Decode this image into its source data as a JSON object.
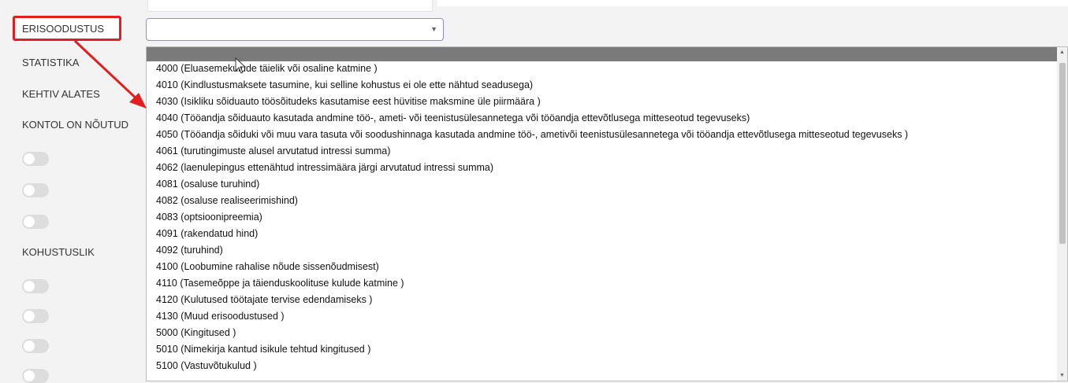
{
  "labels": {
    "erisoodustus": "ERISOODUSTUS",
    "statistika": "STATISTIKA",
    "kehtiv_alates": "KEHTIV ALATES",
    "kontol_on_noutud": "KONTOL ON NÕUTUD",
    "kohustuslik": "KOHUSTUSLIK"
  },
  "select": {
    "value": "",
    "caret": "▼"
  },
  "dropdown": {
    "options": [
      "4000 (Eluasemekulude täielik või osaline katmine )",
      "4010 (Kindlustusmaksete tasumine, kui selline kohustus ei ole ette nähtud seadusega)",
      "4030 (Isikliku sõiduauto töösõitudeks kasutamise eest hüvitise maksmine üle piirmäära )",
      "4040 (Tööandja sõiduauto kasutada andmine töö-, ameti- või teenistusülesannetega või tööandja ettevõtlusega mitteseotud tegevuseks)",
      "4050 (Tööandja sõiduki või muu vara tasuta või soodushinnaga kasutada andmine töö-, ametivõi teenistusülesannetega või tööandja ettevõtlusega mitteseotud tegevuseks )",
      "4061 (turutingimuste alusel arvutatud intressi summa)",
      "4062 (laenulepingus ettenähtud intressimäära järgi arvutatud intressi summa)",
      "4081 (osaluse turuhind)",
      "4082 (osaluse realiseerimishind)",
      "4083 (optsioonipreemia)",
      "4091 (rakendatud hind)",
      "4092 (turuhind)",
      "4100 (Loobumine rahalise nõude sissenõudmisest)",
      "4110 (Tasemeõppe ja täienduskoolituse kulude katmine )",
      "4120 (Kulutused töötajate tervise edendamiseks )",
      "4130 (Muud erisoodustused )",
      "5000 (Kingitused )",
      "5010 (Nimekirja kantud isikule tehtud kingitused )",
      "5100 (Vastuvõtukulud )"
    ]
  },
  "colors": {
    "annotation": "#e02020",
    "highlight": "#7a7a7a"
  }
}
